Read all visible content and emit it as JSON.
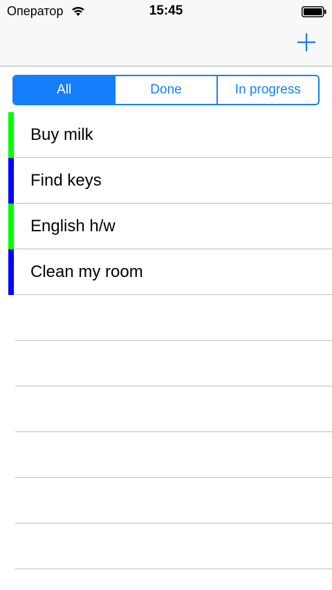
{
  "status_bar": {
    "carrier": "Оператор",
    "time": "15:45"
  },
  "nav_bar": {
    "add_icon": "plus-icon",
    "accent": "#147efb"
  },
  "filter": {
    "segments": [
      "All",
      "Done",
      "In progress"
    ],
    "selected": "All"
  },
  "tasks": [
    {
      "title": "Buy milk",
      "status_color": "#00ff00"
    },
    {
      "title": "Find keys",
      "status_color": "#0000ff"
    },
    {
      "title": "English h/w",
      "status_color": "#00ff00"
    },
    {
      "title": "Clean my room",
      "status_color": "#0000ff"
    }
  ],
  "empty_rows": 6
}
